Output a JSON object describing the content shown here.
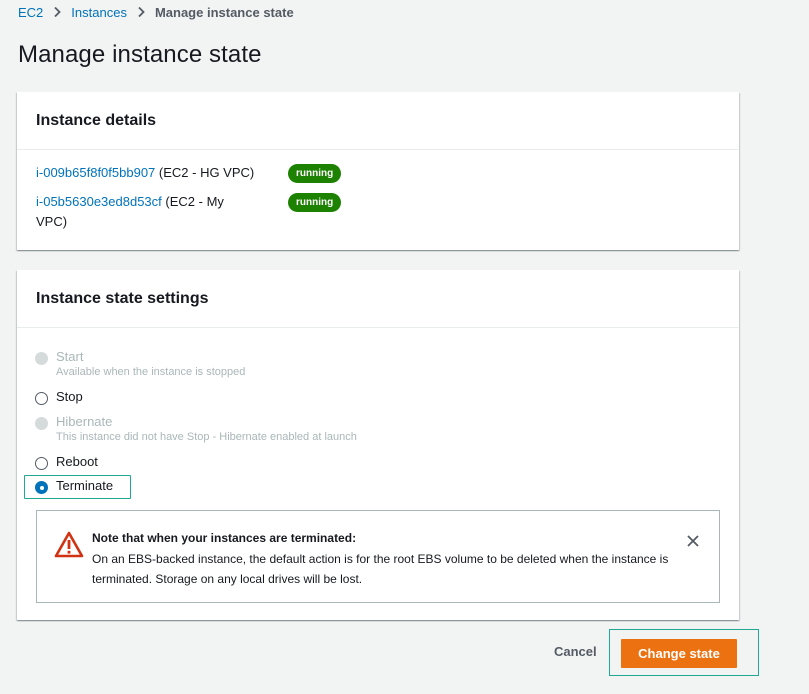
{
  "breadcrumb": {
    "items": [
      "EC2",
      "Instances"
    ],
    "current": "Manage instance state"
  },
  "page": {
    "title": "Manage instance state"
  },
  "instance_details": {
    "title": "Instance details",
    "instances": [
      {
        "id": "i-009b65f8f0f5bb907",
        "vpc": " (EC2 - HG VPC)",
        "state": "running"
      },
      {
        "id": "i-05b5630e3ed8d53cf",
        "vpc": " (EC2 - My VPC)",
        "state": "running"
      }
    ]
  },
  "state_settings": {
    "title": "Instance state settings",
    "options": [
      {
        "label": "Start",
        "description": "Available when the instance is stopped",
        "disabled": true,
        "checked": false
      },
      {
        "label": "Stop",
        "description": "",
        "disabled": false,
        "checked": false
      },
      {
        "label": "Hibernate",
        "description": "This instance did not have Stop - Hibernate enabled at launch",
        "disabled": true,
        "checked": false
      },
      {
        "label": "Reboot",
        "description": "",
        "disabled": false,
        "checked": false
      },
      {
        "label": "Terminate",
        "description": "",
        "disabled": false,
        "checked": true
      }
    ]
  },
  "alert": {
    "icon": "warning-icon",
    "title": "Note that when your instances are terminated:",
    "body": "On an EBS-backed instance, the default action is for the root EBS volume to be deleted when the instance is terminated. Storage on any local drives will be lost.",
    "close_icon": "close-icon"
  },
  "footer": {
    "cancel_label": "Cancel",
    "submit_label": "Change state"
  },
  "colors": {
    "link": "#0073bb",
    "running_badge": "#1d8102",
    "primary_button": "#ec7211",
    "alert_icon": "#d13212",
    "focus_ring": "#21a892"
  }
}
